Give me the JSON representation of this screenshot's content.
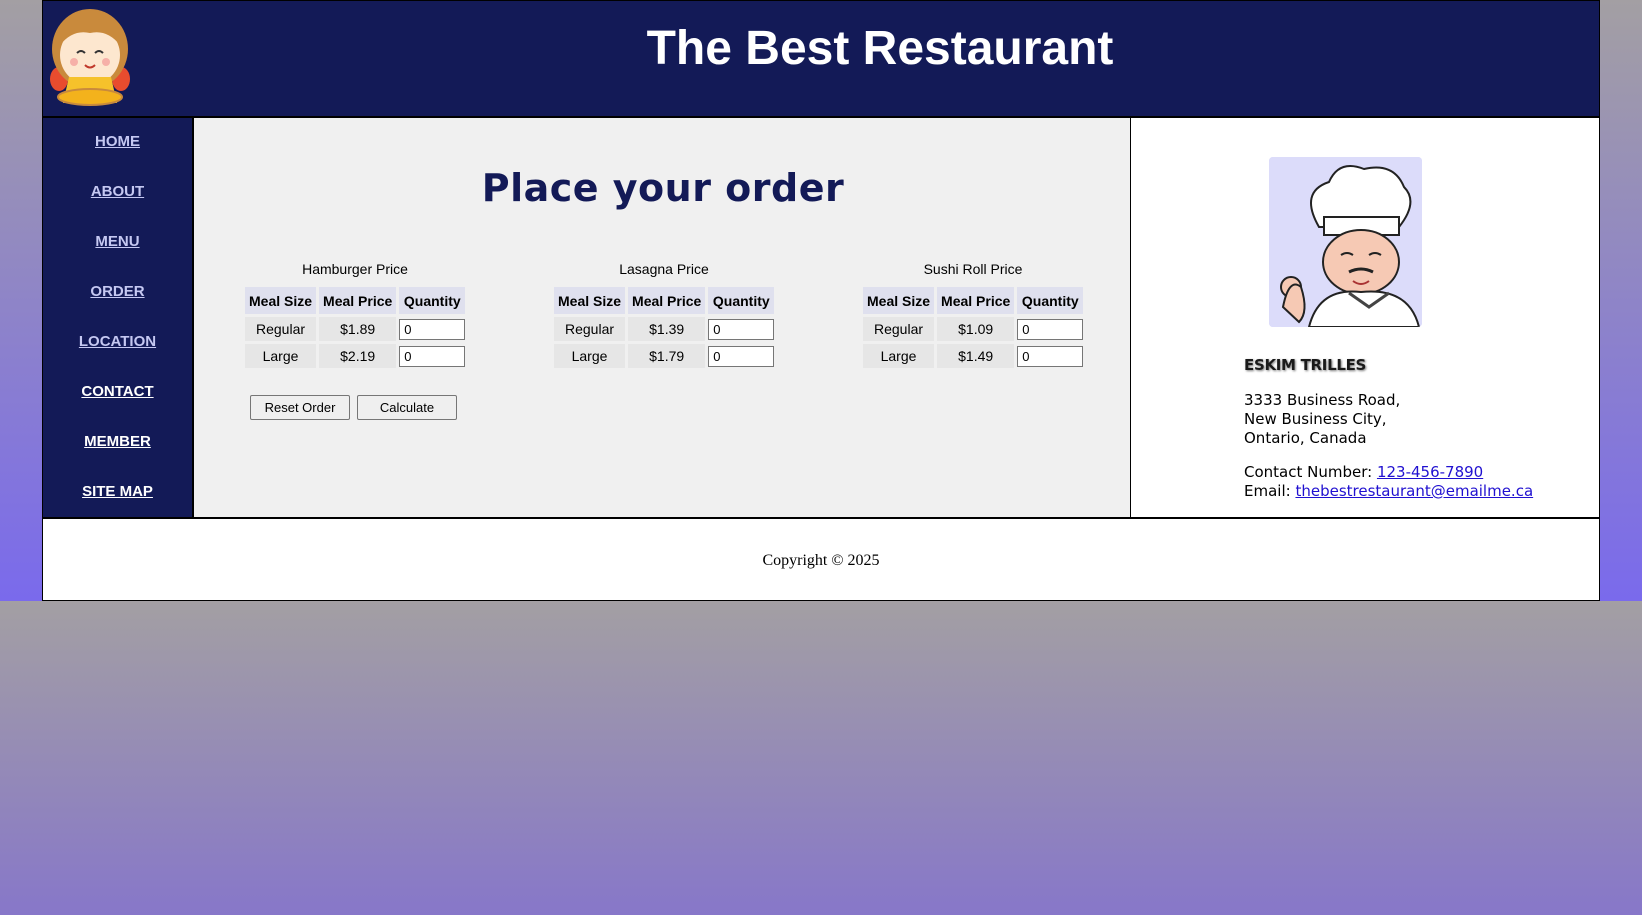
{
  "header": {
    "title": "The Best Restaurant"
  },
  "nav": {
    "items": [
      {
        "label": "HOME"
      },
      {
        "label": "ABOUT"
      },
      {
        "label": "MENU"
      },
      {
        "label": "ORDER"
      },
      {
        "label": "LOCATION"
      },
      {
        "label": "CONTACT"
      },
      {
        "label": "MEMBER"
      },
      {
        "label": "SITE MAP"
      }
    ]
  },
  "main": {
    "heading": "Place your order",
    "columns": [
      "Meal Size",
      "Meal Price",
      "Quantity"
    ],
    "menus": [
      {
        "caption": "Hamburger Price",
        "rows": [
          {
            "size": "Regular",
            "price": "$1.89",
            "qty": "0"
          },
          {
            "size": "Large",
            "price": "$2.19",
            "qty": "0"
          }
        ]
      },
      {
        "caption": "Lasagna Price",
        "rows": [
          {
            "size": "Regular",
            "price": "$1.39",
            "qty": "0"
          },
          {
            "size": "Large",
            "price": "$1.79",
            "qty": "0"
          }
        ]
      },
      {
        "caption": "Sushi Roll Price",
        "rows": [
          {
            "size": "Regular",
            "price": "$1.09",
            "qty": "0"
          },
          {
            "size": "Large",
            "price": "$1.49",
            "qty": "0"
          }
        ]
      }
    ],
    "buttons": {
      "reset": "Reset Order",
      "calculate": "Calculate"
    }
  },
  "aside": {
    "name": "ESKIM TRILLES",
    "address": [
      "3333 Business Road,",
      "New Business City,",
      "Ontario, Canada"
    ],
    "contact_label": "Contact Number: ",
    "phone": "123-456-7890",
    "email_label": "Email: ",
    "email": "thebestrestaurant@emailme.ca"
  },
  "footer": {
    "copyright": "Copyright © 2025"
  },
  "colors": {
    "header_bg": "#131a57",
    "nav_link": "#c5c8f2",
    "link": "#2010d0"
  }
}
